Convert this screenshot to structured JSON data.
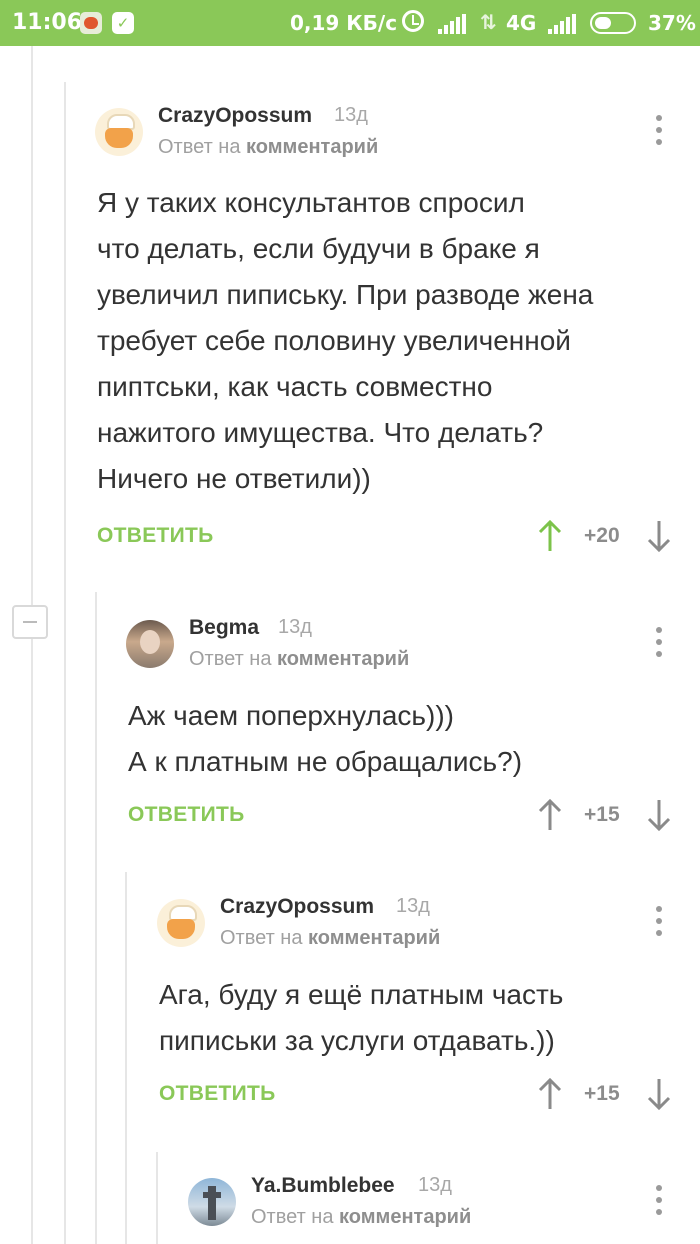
{
  "status_bar": {
    "time": "11:06",
    "speed": "0,19 КБ/с",
    "network": "4G",
    "battery": "37%",
    "accent": "#8ac858"
  },
  "reply_prefix": "Ответ на",
  "reply_target": "комментарий",
  "reply_button": "ОТВЕТИТЬ",
  "comments": [
    {
      "author": "CrazyOpossum",
      "time": "13д",
      "text": [
        "Я у таких консультантов спросил",
        "что делать, если будучи в браке я",
        "увеличил пипиську. При разводе жена",
        "требует себе половину увеличенной",
        "пиптськи, как часть совместно",
        "нажитого имущества. Что делать?",
        "Ничего не ответили))"
      ],
      "score": "+20",
      "upvoted": true
    },
    {
      "author": "Begma",
      "time": "13д",
      "text": [
        "Аж чаем поперхнулась)))",
        "А к платным не обращались?)"
      ],
      "score": "+15",
      "upvoted": false
    },
    {
      "author": "CrazyOpossum",
      "time": "13д",
      "text": [
        "Ага, буду я ещё платным часть",
        "пиписьки за услуги отдавать.))"
      ],
      "score": "+15",
      "upvoted": false
    },
    {
      "author": "Ya.Bumblebee",
      "time": "13д"
    }
  ]
}
